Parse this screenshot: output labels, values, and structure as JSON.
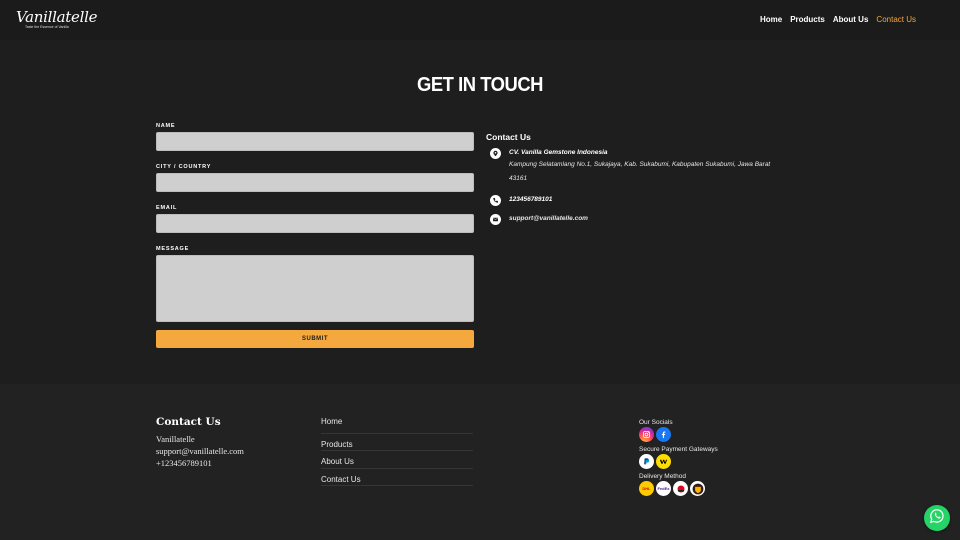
{
  "header": {
    "logo_text": "Vanillatelle",
    "logo_tagline": "Taste the Essence of Vanilla",
    "nav": [
      {
        "label": "Home"
      },
      {
        "label": "Products"
      },
      {
        "label": "About Us"
      },
      {
        "label": "Contact Us",
        "active": true
      }
    ]
  },
  "section": {
    "title": "GET IN TOUCH",
    "form": {
      "name_label": "NAME",
      "name_value": "",
      "city_label": "CITY / COUNTRY",
      "city_value": "",
      "email_label": "EMAIL",
      "email_value": "",
      "message_label": "MESSAGE",
      "message_value": "",
      "submit_label": "SUBMIT"
    },
    "contact": {
      "title": "Contact Us",
      "company": "CV. Vanilla Gemstone Indonesia",
      "address_line1": "Kampung Selatamlang No.1, Sukajaya, Kab. Sukabumi, Kabupaten Sukabumi, Jawa Barat",
      "address_line2": "43161",
      "phone": "123456789101",
      "email": "support@vanillatelle.com"
    }
  },
  "footer": {
    "contact_title": "Contact Us",
    "contact_lines": [
      "Vanillatelle",
      "support@vanillatelle.com",
      "+123456789101"
    ],
    "links": [
      "Home",
      "Products",
      "About Us",
      "Contact Us"
    ],
    "socials_label": "Our Socials",
    "payment_label": "Secure Payment Gateways",
    "delivery_label": "Delivery Method",
    "delivery_dhl_text": "DHL",
    "delivery_fedex_text": "FedEx"
  },
  "colors": {
    "accent": "#f5a83e",
    "background": "#1e1e1e",
    "footer_background": "#222222",
    "whatsapp": "#25d366"
  },
  "icons": [
    "location-pin-icon",
    "phone-icon",
    "envelope-icon",
    "instagram-icon",
    "facebook-icon",
    "paypal-icon",
    "western-union-icon",
    "dhl-icon",
    "fedex-icon",
    "sicepat-icon",
    "ups-icon",
    "whatsapp-icon"
  ]
}
